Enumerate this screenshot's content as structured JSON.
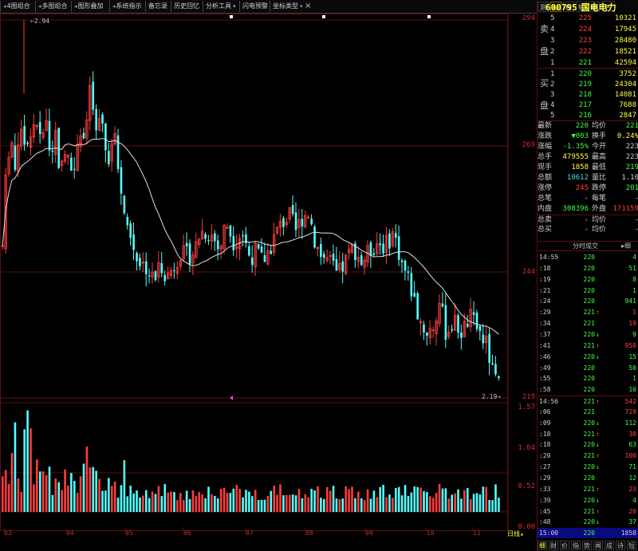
{
  "toolbar": {
    "buttons": [
      "4图组合",
      "多图组合",
      "图形叠加",
      "系统指示",
      "备忘录",
      "历史回忆",
      "分析工具",
      "闪电预警",
      "坐标类型"
    ],
    "close": "×"
  },
  "chart": {
    "high_label": "2.94",
    "low_label": "2.19",
    "price_axis": [
      "294",
      "269",
      "244",
      "219"
    ],
    "volume_axis": [
      "1.57",
      "1.04",
      "0.52",
      "0.00"
    ],
    "date_labels": [
      "03",
      "04",
      "05",
      "06",
      "07",
      "08",
      "09",
      "10",
      "11"
    ],
    "period_label": "日线",
    "colors": {
      "up": "#ff3c3c",
      "down": "#54ffff",
      "ma": "#e0e0e0",
      "grid": "#5a1010",
      "axis_text": "#d03030"
    }
  },
  "chart_data": {
    "type": "candlestick",
    "ylim": [
      219,
      294
    ],
    "high": 2.94,
    "low": 2.19,
    "volume_ylim": [
      0.0,
      1.57
    ],
    "volume_ticks": [
      0.0,
      0.52,
      1.04,
      1.57
    ]
  },
  "right_panel": {
    "tabs": [
      "测",
      "标",
      "权",
      "较",
      "移"
    ],
    "stock_code": "600795",
    "stock_name": "国电电力",
    "sell_label": [
      "卖",
      "盘"
    ],
    "buy_label": [
      "买",
      "盘"
    ],
    "sell_orders": [
      {
        "level": "5",
        "price": "225",
        "vol": "10321"
      },
      {
        "level": "4",
        "price": "224",
        "vol": "17945"
      },
      {
        "level": "3",
        "price": "223",
        "vol": "28480"
      },
      {
        "level": "2",
        "price": "222",
        "vol": "18521"
      },
      {
        "level": "1",
        "price": "221",
        "vol": "42594"
      }
    ],
    "buy_orders": [
      {
        "level": "1",
        "price": "220",
        "vol": "3752"
      },
      {
        "level": "2",
        "price": "219",
        "vol": "24304"
      },
      {
        "level": "3",
        "price": "218",
        "vol": "14081"
      },
      {
        "level": "4",
        "price": "217",
        "vol": "7688"
      },
      {
        "level": "5",
        "price": "216",
        "vol": "2847"
      }
    ],
    "quote": [
      {
        "l1": "最新",
        "v1": "220",
        "c1": "green",
        "l2": "均价",
        "v2": "221",
        "c2": "green"
      },
      {
        "l1": "涨跌",
        "v1": "▼003",
        "c1": "green",
        "l2": "换手",
        "v2": "0.24%",
        "c2": "yellow"
      },
      {
        "l1": "涨幅",
        "v1": "-1.35%",
        "c1": "green",
        "l2": "今开",
        "v2": "223",
        "c2": "white"
      },
      {
        "l1": "总手",
        "v1": "479555",
        "c1": "yellow",
        "l2": "最高",
        "v2": "223",
        "c2": "white"
      },
      {
        "l1": "现手",
        "v1": "1858",
        "c1": "yellow",
        "l2": "最低",
        "v2": "219",
        "c2": "green"
      },
      {
        "l1": "总额",
        "v1": "10612",
        "c1": "cyan",
        "l2": "量比",
        "v2": "1.10",
        "c2": "white"
      },
      {
        "l1": "涨停",
        "v1": "245",
        "c1": "red",
        "l2": "跌停",
        "v2": "201",
        "c2": "green"
      },
      {
        "l1": "总笔",
        "v1": "-",
        "c1": "white",
        "l2": "每笔",
        "v2": "-",
        "c2": "white"
      },
      {
        "l1": "内盘",
        "v1": "308396",
        "c1": "green",
        "l2": "外盘",
        "v2": "171159",
        "c2": "red"
      },
      {
        "l1": "总卖",
        "v1": "-",
        "c1": "white",
        "l2": "均价",
        "v2": "-",
        "c2": "white"
      },
      {
        "l1": "总买",
        "v1": "-",
        "c1": "white",
        "l2": "均价",
        "v2": "-",
        "c2": "white"
      }
    ],
    "ticks_header": "分时成交",
    "ticks_tab": "细",
    "ticks": [
      {
        "t": "14:55",
        "p": "220",
        "a": "",
        "v": "4",
        "pc": "green",
        "vc": "green"
      },
      {
        "t": ":18",
        "p": "220",
        "a": "",
        "v": "51",
        "pc": "green",
        "vc": "green"
      },
      {
        "t": ":19",
        "p": "220",
        "a": "",
        "v": "8",
        "pc": "green",
        "vc": "green"
      },
      {
        "t": ":21",
        "p": "220",
        "a": "",
        "v": "1",
        "pc": "green",
        "vc": "green"
      },
      {
        "t": ":24",
        "p": "220",
        "a": "",
        "v": "941",
        "pc": "green",
        "vc": "green"
      },
      {
        "t": ":29",
        "p": "221",
        "a": "↑",
        "v": "1",
        "pc": "green",
        "vc": "red"
      },
      {
        "t": ":34",
        "p": "221",
        "a": "",
        "v": "19",
        "pc": "green",
        "vc": "red"
      },
      {
        "t": ":37",
        "p": "220",
        "a": "↓",
        "v": "9",
        "pc": "green",
        "vc": "green"
      },
      {
        "t": ":41",
        "p": "221",
        "a": "↑",
        "v": "958",
        "pc": "green",
        "vc": "red"
      },
      {
        "t": ":46",
        "p": "220",
        "a": "↓",
        "v": "15",
        "pc": "green",
        "vc": "green"
      },
      {
        "t": ":49",
        "p": "220",
        "a": "",
        "v": "50",
        "pc": "green",
        "vc": "green"
      },
      {
        "t": ":55",
        "p": "220",
        "a": "",
        "v": "1",
        "pc": "green",
        "vc": "green"
      },
      {
        "t": ":58",
        "p": "220",
        "a": "",
        "v": "10",
        "pc": "green",
        "vc": "green"
      },
      {
        "t": "14:56",
        "p": "221",
        "a": "↑",
        "v": "542",
        "pc": "green",
        "vc": "red"
      },
      {
        "t": ":06",
        "p": "221",
        "a": "",
        "v": "719",
        "pc": "green",
        "vc": "red"
      },
      {
        "t": ":09",
        "p": "220",
        "a": "↓",
        "v": "112",
        "pc": "green",
        "vc": "green"
      },
      {
        "t": ":18",
        "p": "221",
        "a": "↑",
        "v": "30",
        "pc": "green",
        "vc": "red"
      },
      {
        "t": ":18",
        "p": "220",
        "a": "↓",
        "v": "63",
        "pc": "green",
        "vc": "green"
      },
      {
        "t": ":20",
        "p": "221",
        "a": "↑",
        "v": "100",
        "pc": "green",
        "vc": "red"
      },
      {
        "t": ":27",
        "p": "220",
        "a": "↓",
        "v": "71",
        "pc": "green",
        "vc": "green"
      },
      {
        "t": ":29",
        "p": "220",
        "a": "",
        "v": "12",
        "pc": "green",
        "vc": "green"
      },
      {
        "t": ":33",
        "p": "221",
        "a": "↑",
        "v": "23",
        "pc": "green",
        "vc": "red"
      },
      {
        "t": ":39",
        "p": "220",
        "a": "↓",
        "v": "4",
        "pc": "green",
        "vc": "green"
      },
      {
        "t": ":45",
        "p": "221",
        "a": "↑",
        "v": "20",
        "pc": "green",
        "vc": "red"
      },
      {
        "t": ":48",
        "p": "220",
        "a": "↓",
        "v": "37",
        "pc": "green",
        "vc": "green"
      },
      {
        "t": "15:00",
        "p": "220",
        "a": "",
        "v": "1858",
        "pc": "green",
        "vc": "white"
      }
    ],
    "bottom_tabs": [
      "细",
      "财",
      "价",
      "指",
      "势",
      "闻",
      "成",
      "诗",
      "短"
    ]
  }
}
